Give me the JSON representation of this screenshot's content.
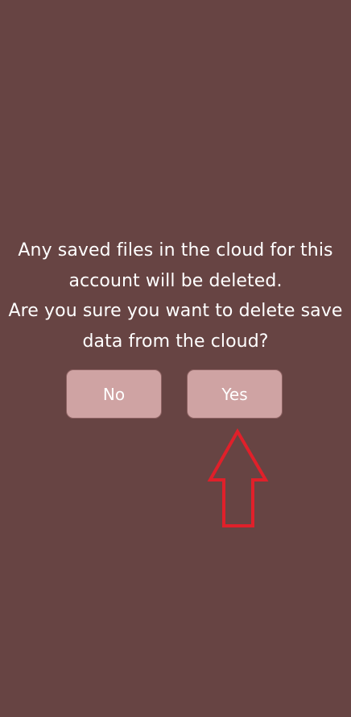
{
  "dialog": {
    "message_lines": [
      "Any saved files in the cloud for this",
      "account will be deleted.",
      "Are you sure you want to delete save",
      "data from the cloud?"
    ],
    "no_label": "No",
    "yes_label": "Yes"
  },
  "colors": {
    "background": "#674443",
    "button_fill": "#cfa3a3",
    "text": "#ffffff",
    "annotation": "#e0202a"
  },
  "annotation": {
    "icon": "up-arrow-icon"
  }
}
